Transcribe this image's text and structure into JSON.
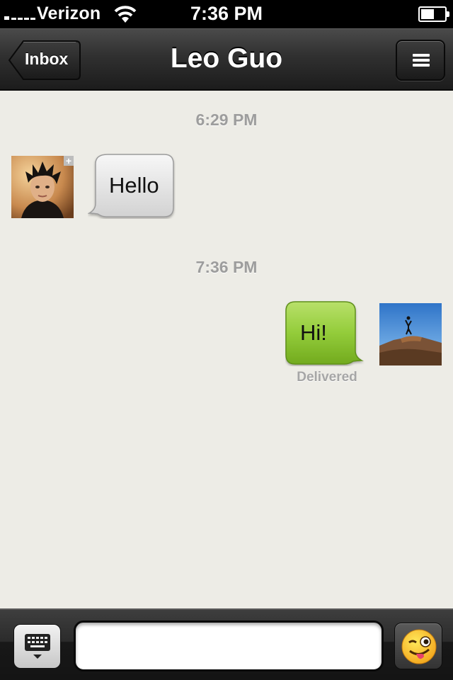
{
  "status_bar": {
    "carrier": "Verizon",
    "time": "7:36 PM",
    "signal_icon": "signal-bars-icon",
    "wifi_icon": "wifi-icon",
    "battery_icon": "battery-icon",
    "battery_level": 0.55
  },
  "nav": {
    "back_label": "Inbox",
    "title": "Leo Guo",
    "menu_icon": "menu-icon"
  },
  "messages": [
    {
      "timestamp": "6:29 PM",
      "sender": "contact",
      "text": "Hello",
      "status": ""
    },
    {
      "timestamp": "7:36 PM",
      "sender": "me",
      "text": "Hi!",
      "status": "Delivered"
    }
  ],
  "input_bar": {
    "keyboard_icon": "keyboard-icon",
    "message_value": "",
    "emoji_icon": "emoji-wink-icon"
  },
  "colors": {
    "background": "#edece6",
    "incoming_bubble": "#e3e3e3",
    "outgoing_bubble": "#8fc93a",
    "timestamp": "#9d9d9d"
  }
}
